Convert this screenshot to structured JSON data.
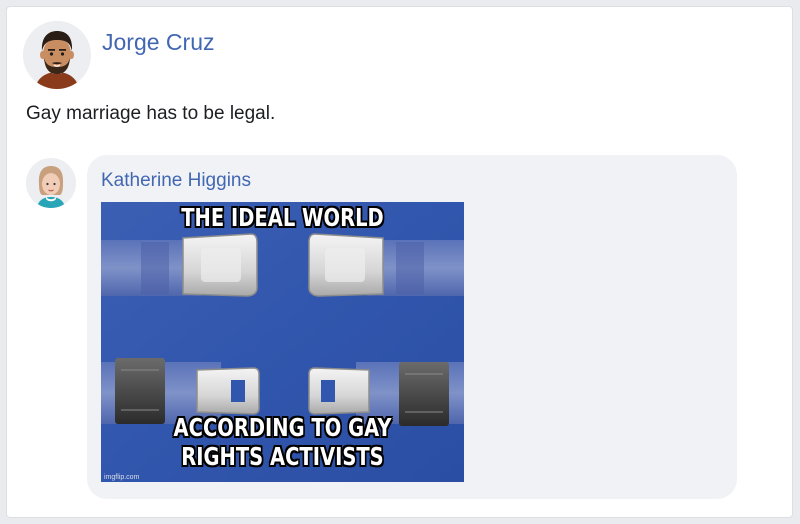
{
  "post": {
    "author": "Jorge Cruz",
    "text": "Gay marriage has to be legal."
  },
  "comment": {
    "author": "Katherine Higgins",
    "meme": {
      "top_caption": "THE IDEAL WORLD",
      "bottom_caption_line1": "ACCORDING TO GAY",
      "bottom_caption_line2": "RIGHTS ACTIVISTS",
      "watermark": "imgflip.com"
    }
  },
  "colors": {
    "link": "#4267b2",
    "bubble": "#f0f2f5",
    "background": "#e9ebee"
  },
  "icons": {
    "author_avatar": "man-with-beard-avatar-icon",
    "comment_avatar": "woman-avatar-icon"
  }
}
